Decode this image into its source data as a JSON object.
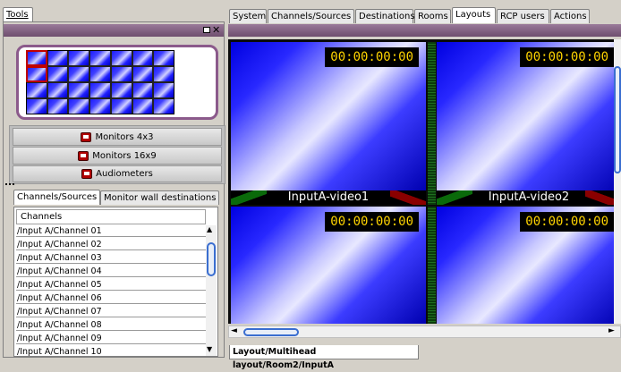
{
  "left_panel": {
    "tools_tab": "Tools",
    "groups": [
      "Monitors 4x3",
      "Monitors 16x9",
      "Audiometers"
    ],
    "subtabs": [
      "Channels/Sources",
      "Monitor wall destinations"
    ],
    "list_header": "Channels",
    "channels": [
      "/Input A/Channel 01",
      "/Input A/Channel 02",
      "/Input A/Channel 03",
      "/Input A/Channel 04",
      "/Input A/Channel 05",
      "/Input A/Channel 06",
      "/Input A/Channel 07",
      "/Input A/Channel 08",
      "/Input A/Channel 09",
      "/Input A/Channel 10"
    ]
  },
  "top_tabs": [
    "System",
    "Channels/Sources",
    "Destinations",
    "Rooms",
    "Layouts",
    "RCP users",
    "Actions"
  ],
  "active_tab": "Layouts",
  "monitors": [
    {
      "timecode": "00:00:00:00",
      "label": "InputA-video1"
    },
    {
      "timecode": "00:00:00:00",
      "label": "InputA-video2"
    },
    {
      "timecode": "00:00:00:00",
      "label": ""
    },
    {
      "timecode": "00:00:00:00",
      "label": ""
    }
  ],
  "bottom_tab": "Layout/Multihead layout/Room2/InputA",
  "colors": {
    "panel": "#d4d0c8",
    "preview_border": "#8b5a8b",
    "timecode": "#ffd400",
    "title_bar": "#7e5a7e"
  }
}
